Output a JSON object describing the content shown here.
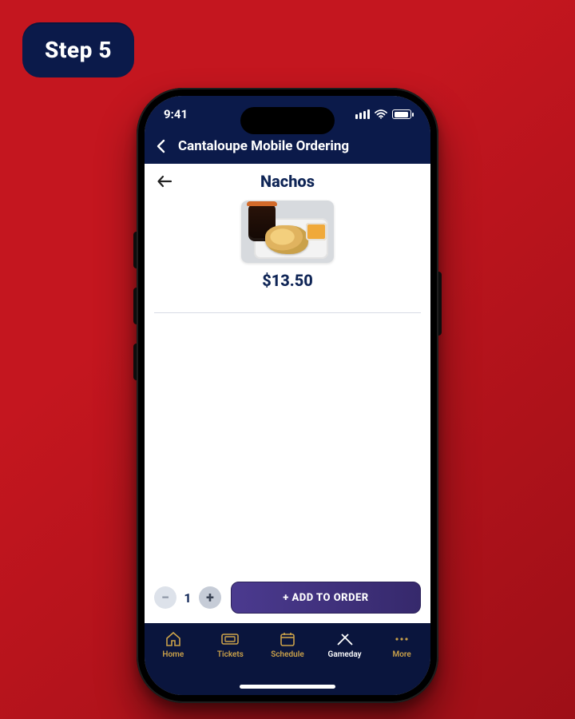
{
  "step_label": "Step 5",
  "status": {
    "time": "9:41"
  },
  "appbar": {
    "title": "Cantaloupe Mobile Ordering"
  },
  "product": {
    "name": "Nachos",
    "price_display": "$13.50"
  },
  "order": {
    "quantity": "1",
    "add_label": "+ ADD TO ORDER"
  },
  "tabs": {
    "home": "Home",
    "tickets": "Tickets",
    "schedule": "Schedule",
    "gameday": "Gameday",
    "more": "More"
  }
}
